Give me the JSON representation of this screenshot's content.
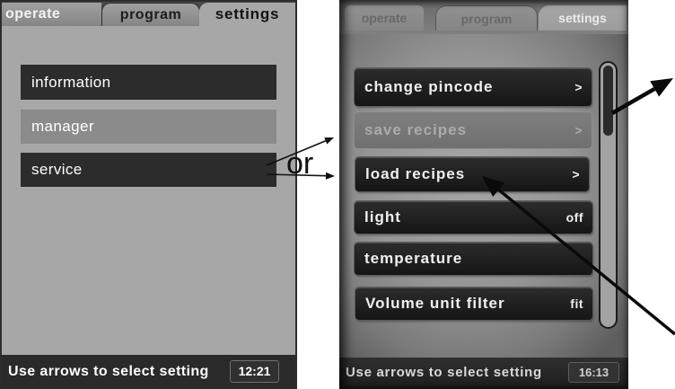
{
  "colors": {
    "screen_gray": "#a7a7a7",
    "item_dark": "#2c2c2c",
    "item_disabled": "#8b8b8b",
    "status_bar": "#2a2a2a",
    "text_light": "#ffffff"
  },
  "left_screen": {
    "tabs": [
      {
        "label": "operate",
        "active": false
      },
      {
        "label": "program",
        "active": false
      },
      {
        "label": "settings",
        "active": true
      }
    ],
    "menu_items": [
      {
        "label": "information",
        "enabled": true
      },
      {
        "label": "manager",
        "enabled": false
      },
      {
        "label": "service",
        "enabled": true
      }
    ],
    "status_text": "Use arrows to select setting",
    "clock": "12:21"
  },
  "connector_text": "or",
  "right_screen": {
    "tabs": [
      {
        "label": "operate",
        "active": false
      },
      {
        "label": "program",
        "active": false
      },
      {
        "label": "settings",
        "active": true
      }
    ],
    "menu_items": [
      {
        "label": "change pincode",
        "value": ">",
        "enabled": true
      },
      {
        "label": "save recipes",
        "value": ">",
        "enabled": false
      },
      {
        "label": "load recipes",
        "value": ">",
        "enabled": true
      },
      {
        "label": "light",
        "value": "off",
        "enabled": true
      },
      {
        "label": "temperature",
        "enabled": true
      },
      {
        "label": "Volume unit filter",
        "value": "fit",
        "enabled": true
      }
    ],
    "scrollbar": {
      "position_percent": 0,
      "visible_percent": 27
    },
    "status_text": "Use arrows to select setting",
    "clock": "16:13"
  }
}
